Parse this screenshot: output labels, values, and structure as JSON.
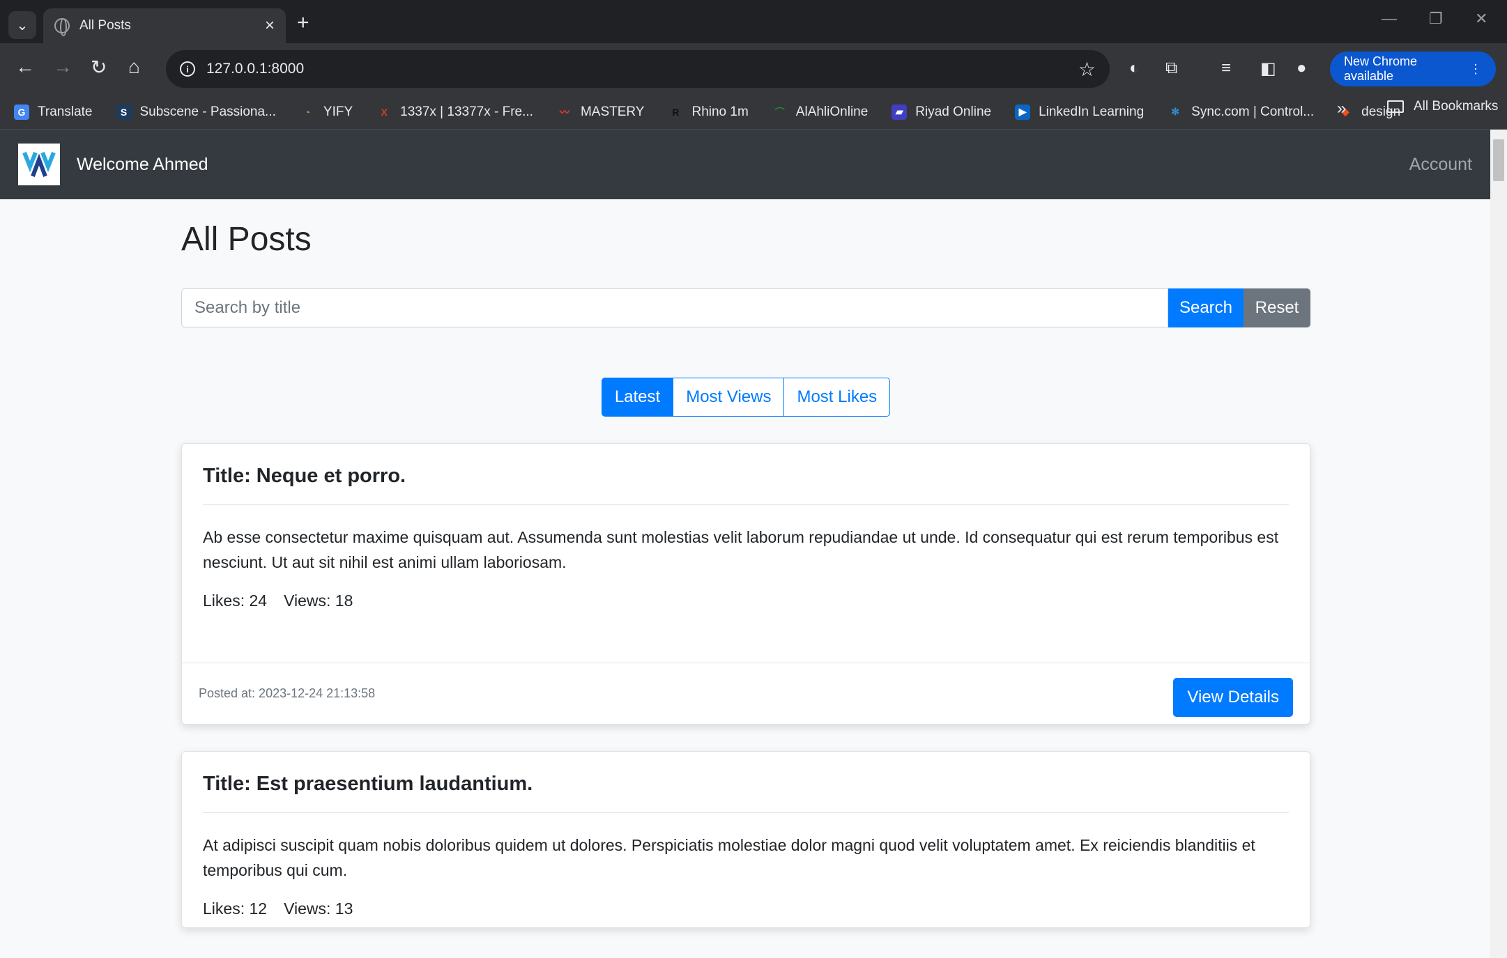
{
  "browser": {
    "tab_title": "All Posts",
    "url": "127.0.0.1:8000",
    "new_chrome_label": "New Chrome available",
    "bookmarks": [
      {
        "label": "Translate",
        "icon": "google-translate-icon",
        "color": "#4285f4"
      },
      {
        "label": "Subscene - Passiona...",
        "icon": "subscene-icon",
        "color": "#1e3a5f"
      },
      {
        "label": "YIFY",
        "icon": "yify-icon",
        "color": "#3c763d"
      },
      {
        "label": "1337x | 13377x - Fre...",
        "icon": "1337x-icon",
        "color": "#d63c2f"
      },
      {
        "label": "MASTERY",
        "icon": "mastery-icon",
        "color": "#e53935"
      },
      {
        "label": "Rhino 1m",
        "icon": "rhino-icon",
        "color": "#222222"
      },
      {
        "label": "AlAhliOnline",
        "icon": "alahli-icon",
        "color": "#1b8a3d"
      },
      {
        "label": "Riyad Online",
        "icon": "riyad-icon",
        "color": "#3f3fbf"
      },
      {
        "label": "LinkedIn Learning",
        "icon": "linkedin-learning-icon",
        "color": "#0a66c2"
      },
      {
        "label": "Sync.com | Control...",
        "icon": "sync-icon",
        "color": "#2d8fd5"
      },
      {
        "label": "design",
        "icon": "figma-icon",
        "color": "#f24e1e"
      }
    ],
    "all_bookmarks_label": "All Bookmarks"
  },
  "navbar": {
    "brand": "Welcome Ahmed",
    "account": "Account"
  },
  "page": {
    "title": "All Posts",
    "search": {
      "placeholder": "Search by title",
      "search_label": "Search",
      "reset_label": "Reset"
    },
    "sort": {
      "latest": "Latest",
      "most_views": "Most Views",
      "most_likes": "Most Likes"
    },
    "view_details_label": "View Details",
    "posts": [
      {
        "title": "Title: Neque et porro.",
        "body": "Ab esse consectetur maxime quisquam aut. Assumenda sunt molestias velit laborum repudiandae ut unde. Id consequatur qui est rerum temporibus est nesciunt. Ut aut sit nihil est animi ullam laboriosam.",
        "likes": "Likes: 24",
        "views": "Views: 18",
        "posted": "Posted at: 2023-12-24 21:13:58"
      },
      {
        "title": "Title: Est praesentium laudantium.",
        "body": "At adipisci suscipit quam nobis doloribus quidem ut dolores. Perspiciatis molestiae dolor magni quod velit voluptatem amet. Ex reiciendis blanditiis et temporibus qui cum.",
        "likes": "Likes: 12",
        "views": "Views: 13"
      }
    ]
  },
  "colors": {
    "primary": "#007bff",
    "secondary": "#6c757d",
    "navbar_bg": "#343a40"
  }
}
